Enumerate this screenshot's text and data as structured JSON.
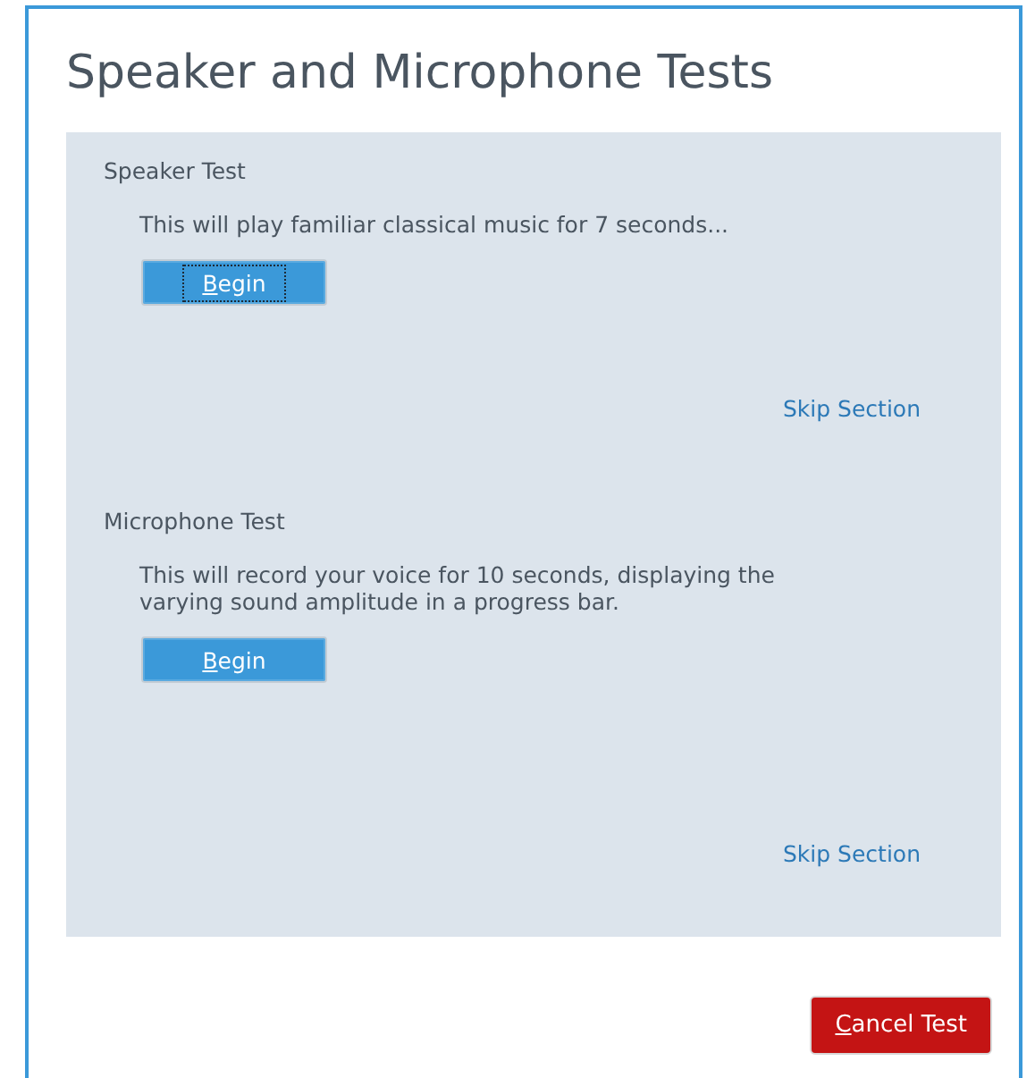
{
  "window": {
    "title": "Speaker and Microphone Tests"
  },
  "sections": [
    {
      "heading": "Speaker Test",
      "description": "This will play familiar classical music for 7 seconds...",
      "button": {
        "label": "Begin",
        "focused": true
      },
      "skip_link": "Skip Section"
    },
    {
      "heading": "Microphone Test",
      "description": "This will record your voice for 10 seconds, displaying the varying sound amplitude in a progress bar.",
      "button": {
        "label": "Begin",
        "focused": false
      },
      "skip_link": "Skip Section"
    }
  ],
  "buttons": [
    {
      "label": "Cancel Test",
      "kind": "destructive"
    }
  ]
}
